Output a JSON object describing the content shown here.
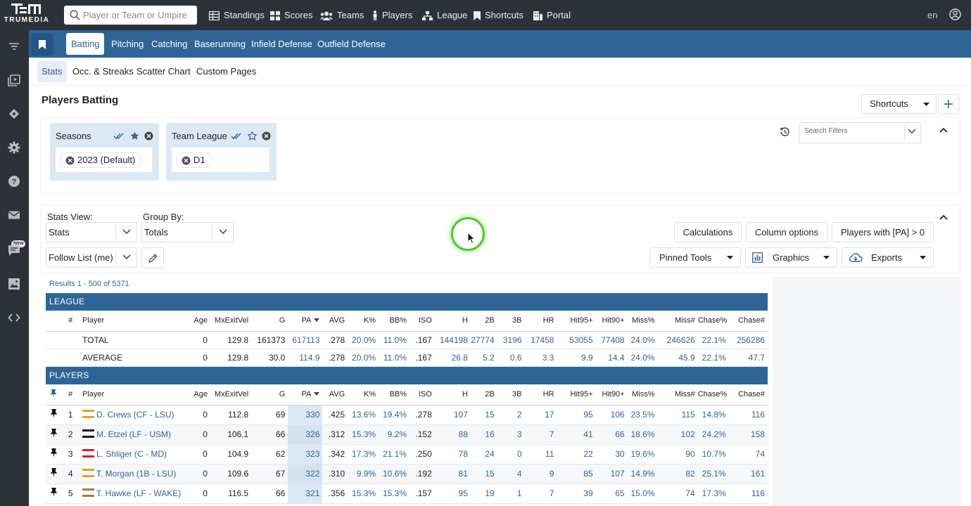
{
  "app": {
    "logo_text": "TRUMEDIA"
  },
  "search": {
    "placeholder": "Player or Team or Umpire"
  },
  "topnav": [
    {
      "label": "Standings",
      "icon": "table-icon"
    },
    {
      "label": "Scores",
      "icon": "grid-icon"
    },
    {
      "label": "Teams",
      "icon": "users-icon"
    },
    {
      "label": "Players",
      "icon": "person-icon"
    },
    {
      "label": "League",
      "icon": "sitemap-icon"
    },
    {
      "label": "Shortcuts",
      "icon": "bookmark-icon"
    },
    {
      "label": "Portal",
      "icon": "building-icon"
    }
  ],
  "lang": "en",
  "sidebar": {
    "new_badge": "New"
  },
  "tabs": [
    "Batting",
    "Pitching",
    "Catching",
    "Baserunning",
    "Infield Defense",
    "Outfield Defense"
  ],
  "subtabs": [
    "Stats",
    "Occ. & Streaks",
    "Scatter Chart",
    "Custom Pages"
  ],
  "page_title": "Players Batting",
  "shortcuts_label": "Shortcuts",
  "filters": {
    "cards": [
      {
        "title": "Seasons",
        "chip": "2023 (Default)"
      },
      {
        "title": "Team League",
        "chip": "D1"
      }
    ],
    "search_placeholder": "Search Filters"
  },
  "controls": {
    "stats_view_label": "Stats View:",
    "stats_view_value": "Stats",
    "group_by_label": "Group By:",
    "group_by_value": "Totals",
    "follow_list_value": "Follow List (me)",
    "calculations": "Calculations",
    "column_options": "Column options",
    "players_with": "Players with [PA] > 0",
    "pinned_tools": "Pinned Tools",
    "graphics": "Graphics",
    "exports": "Exports"
  },
  "results_count": "Results 1 - 500 of 5371",
  "columns": [
    "#",
    "Player",
    "Age",
    "MxExitVel",
    "G",
    "PA",
    "AVG",
    "K%",
    "BB%",
    "ISO",
    "H",
    "2B",
    "3B",
    "HR",
    "Hit95+",
    "Hit90+",
    "Miss%",
    "Miss#",
    "Chase%",
    "Chase#"
  ],
  "league": {
    "header": "LEAGUE",
    "rows": [
      {
        "player": "TOTAL",
        "age": "0",
        "mxexitvel": "129.8",
        "g": "161373",
        "pa": "617113",
        "avg": ".278",
        "k_pct": "20.0%",
        "bb_pct": "11.0%",
        "iso": ".167",
        "h": "144198",
        "b2": "27774",
        "b3": "3196",
        "hr": "17458",
        "hit95": "53055",
        "hit90": "77408",
        "miss_pct": "24.0%",
        "miss_n": "246626",
        "chase_pct": "22.1%",
        "chase_n": "256286"
      },
      {
        "player": "AVERAGE",
        "age": "0",
        "mxexitvel": "129.8",
        "g": "30.0",
        "pa": "114.9",
        "avg": ".278",
        "k_pct": "20.0%",
        "bb_pct": "11.0%",
        "iso": ".167",
        "h": "26.8",
        "b2": "5.2",
        "b3": "0.6",
        "hr": "3.3",
        "hit95": "9.9",
        "hit90": "14.4",
        "miss_pct": "24.0%",
        "miss_n": "45.9",
        "chase_pct": "22.1%",
        "chase_n": "47.7"
      }
    ]
  },
  "players": {
    "header": "PLAYERS",
    "rows": [
      {
        "rank": "1",
        "team_logo": "lsu-logo",
        "logo_color": "#d6a72a",
        "player": "D. Crews (CF - LSU)",
        "age": "0",
        "mxexitvel": "112.8",
        "g": "69",
        "pa": "330",
        "avg": ".425",
        "k_pct": "13.6%",
        "bb_pct": "19.4%",
        "iso": ".278",
        "h": "107",
        "b2": "15",
        "b3": "2",
        "hr": "17",
        "hit95": "95",
        "hit90": "106",
        "miss_pct": "23.5%",
        "miss_n": "115",
        "chase_pct": "14.8%",
        "chase_n": "116"
      },
      {
        "rank": "2",
        "team_logo": "usm-logo",
        "logo_color": "#1b1b1b",
        "player": "M. Etzel (LF - USM)",
        "age": "0",
        "mxexitvel": "106.1",
        "g": "66",
        "pa": "326",
        "avg": ".312",
        "k_pct": "15.3%",
        "bb_pct": "9.2%",
        "iso": ".152",
        "h": "88",
        "b2": "16",
        "b3": "3",
        "hr": "7",
        "hit95": "41",
        "hit90": "66",
        "miss_pct": "18.6%",
        "miss_n": "102",
        "chase_pct": "24.2%",
        "chase_n": "158"
      },
      {
        "rank": "3",
        "team_logo": "md-logo",
        "logo_color": "#d3222a",
        "player": "L. Shliger (C - MD)",
        "age": "0",
        "mxexitvel": "104.9",
        "g": "62",
        "pa": "323",
        "avg": ".342",
        "k_pct": "17.3%",
        "bb_pct": "21.1%",
        "iso": ".250",
        "h": "78",
        "b2": "24",
        "b3": "0",
        "hr": "11",
        "hit95": "22",
        "hit90": "30",
        "miss_pct": "19.6%",
        "miss_n": "90",
        "chase_pct": "10.7%",
        "chase_n": "74"
      },
      {
        "rank": "4",
        "team_logo": "lsu-logo",
        "logo_color": "#d6a72a",
        "player": "T. Morgan (1B - LSU)",
        "age": "0",
        "mxexitvel": "109.6",
        "g": "67",
        "pa": "322",
        "avg": ".310",
        "k_pct": "9.9%",
        "bb_pct": "10.6%",
        "iso": ".192",
        "h": "81",
        "b2": "15",
        "b3": "4",
        "hr": "9",
        "hit95": "85",
        "hit90": "107",
        "miss_pct": "14.9%",
        "miss_n": "82",
        "chase_pct": "25.1%",
        "chase_n": "161"
      },
      {
        "rank": "5",
        "team_logo": "wake-logo",
        "logo_color": "#9e7e38",
        "player": "T. Hawke (LF - WAKE)",
        "age": "0",
        "mxexitvel": "116.5",
        "g": "66",
        "pa": "321",
        "avg": ".356",
        "k_pct": "15.3%",
        "bb_pct": "15.3%",
        "iso": ".157",
        "h": "95",
        "b2": "19",
        "b3": "1",
        "hr": "7",
        "hit95": "39",
        "hit90": "65",
        "miss_pct": "15.0%",
        "miss_n": "74",
        "chase_pct": "17.3%",
        "chase_n": "116"
      }
    ]
  },
  "colors": {
    "topbar": "#2d3238",
    "accent_blue": "#2f6596",
    "pa_highlight": "#dce8f3",
    "cursor_ring": "#4cc92c"
  }
}
